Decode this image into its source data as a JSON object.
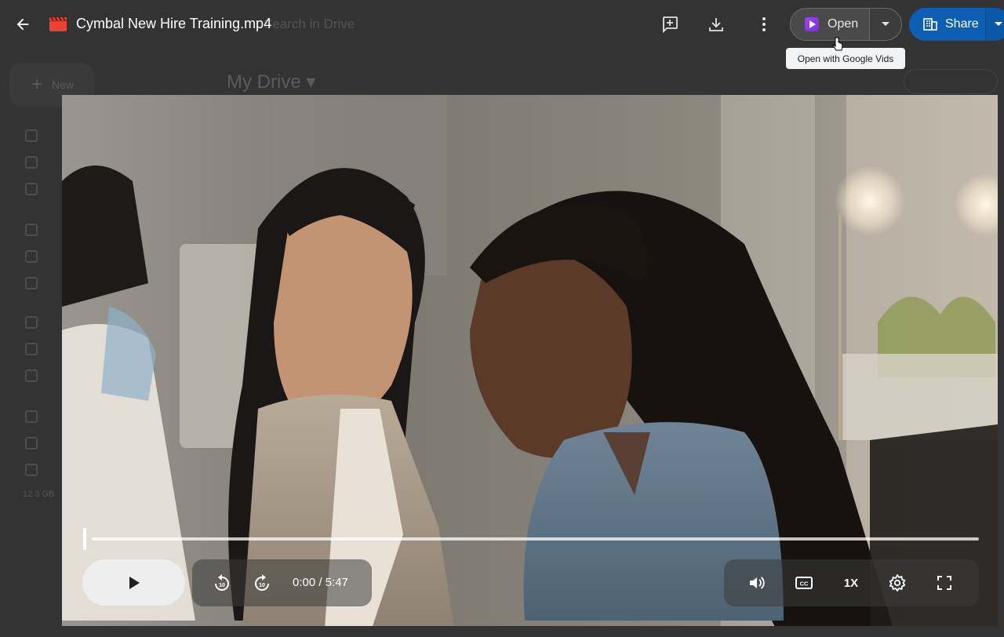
{
  "file": {
    "title": "Cymbal New Hire Training.mp4"
  },
  "toolbar": {
    "open_label": "Open",
    "share_label": "Share",
    "tooltip": "Open with Google Vids"
  },
  "background": {
    "search_placeholder": "Search in Drive",
    "new_label": "New",
    "folder_title": "My Drive",
    "storage": "12.3 GB"
  },
  "player": {
    "time": "0:00 / 5:47",
    "speed_label": "1X",
    "progress": 0,
    "rewind_seconds": 10,
    "forward_seconds": 10
  },
  "colors": {
    "share_blue": "#0e5fb4",
    "vids_purple": "#a142f4",
    "file_red": "#ea4335"
  }
}
